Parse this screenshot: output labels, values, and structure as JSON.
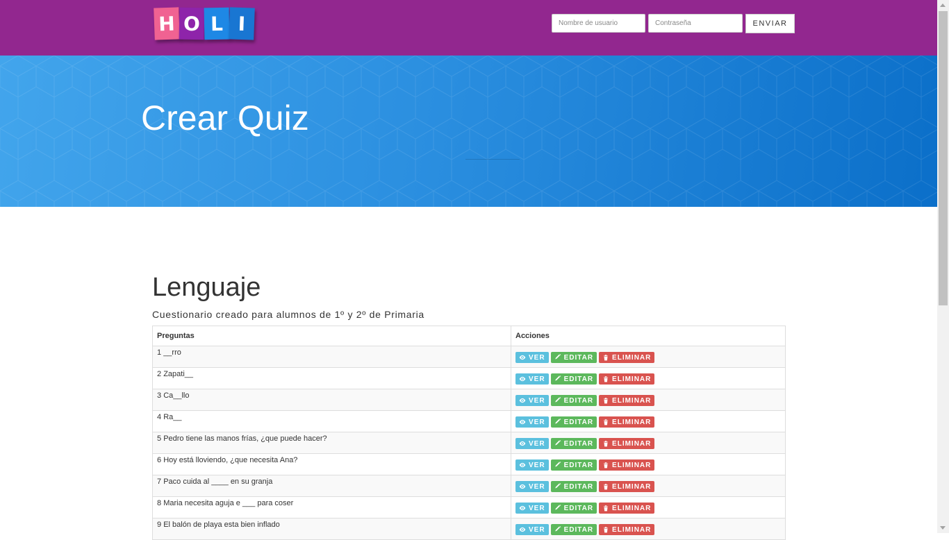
{
  "navbar": {
    "logo_letters": [
      "H",
      "O",
      "L",
      "I"
    ],
    "logo_colors": [
      "#f06292",
      "#9c27b0",
      "#1e88e5",
      "#1565c0"
    ],
    "username_placeholder": "Nombre de usuario",
    "password_placeholder": "Contraseña",
    "submit_label": "ENVIAR",
    "background": "#92278f"
  },
  "hero": {
    "title": "Crear Quiz"
  },
  "section": {
    "title": "Lenguaje",
    "subtitle": "Cuestionario creado para alumnos de 1º y 2º de Primaria"
  },
  "table": {
    "headers": [
      "Preguntas",
      "Acciones"
    ],
    "actions": {
      "view_label": "VER",
      "edit_label": "EDITAR",
      "delete_label": "ELIMINAR",
      "view_color": "#5bc0de",
      "edit_color": "#5cb85c",
      "delete_color": "#d9534f"
    },
    "rows": [
      {
        "number": "1",
        "question": "__rro"
      },
      {
        "number": "2",
        "question": "Zapati__"
      },
      {
        "number": "3",
        "question": "Ca__llo"
      },
      {
        "number": "4",
        "question": "Ra__"
      },
      {
        "number": "5",
        "question": "Pedro tiene las manos frías, ¿que puede hacer?"
      },
      {
        "number": "6",
        "question": "Hoy está lloviendo, ¿que necesita Ana?"
      },
      {
        "number": "7",
        "question": "Paco cuida al ____ en su granja"
      },
      {
        "number": "8",
        "question": "Maria necesita aguja e ___ para coser"
      },
      {
        "number": "9",
        "question": "El balón de playa esta bien inflado"
      }
    ]
  }
}
